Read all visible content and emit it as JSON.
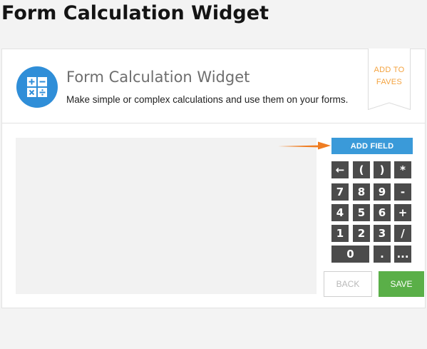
{
  "page": {
    "title": "Form Calculation Widget"
  },
  "widget": {
    "name": "Form Calculation Widget",
    "description": "Make simple or complex calculations and use them on your forms.",
    "icon": "calculator-icon",
    "favorite_label_line1": "ADD TO",
    "favorite_label_line2": "FAVES"
  },
  "calculator": {
    "add_field_label": "ADD FIELD",
    "keys": [
      {
        "name": "backspace-key",
        "label": "←"
      },
      {
        "name": "open-paren-key",
        "label": "("
      },
      {
        "name": "close-paren-key",
        "label": ")"
      },
      {
        "name": "multiply-key",
        "label": "*"
      },
      {
        "name": "key-7",
        "label": "7"
      },
      {
        "name": "key-8",
        "label": "8"
      },
      {
        "name": "key-9",
        "label": "9"
      },
      {
        "name": "minus-key",
        "label": "-"
      },
      {
        "name": "key-4",
        "label": "4"
      },
      {
        "name": "key-5",
        "label": "5"
      },
      {
        "name": "key-6",
        "label": "6"
      },
      {
        "name": "plus-key",
        "label": "+"
      },
      {
        "name": "key-1",
        "label": "1"
      },
      {
        "name": "key-2",
        "label": "2"
      },
      {
        "name": "key-3",
        "label": "3"
      },
      {
        "name": "divide-key",
        "label": "/"
      },
      {
        "name": "key-0",
        "label": "0"
      },
      {
        "name": "decimal-key",
        "label": "."
      },
      {
        "name": "more-key",
        "label": "..."
      }
    ]
  },
  "footer": {
    "back_label": "BACK",
    "save_label": "SAVE"
  },
  "colors": {
    "accent_blue": "#3a9ad9",
    "icon_blue": "#2f8ed8",
    "arrow_orange": "#ef7d22",
    "faves_orange": "#f4a340",
    "key_dark": "#4b4b4b",
    "save_green": "#5aaf48"
  }
}
